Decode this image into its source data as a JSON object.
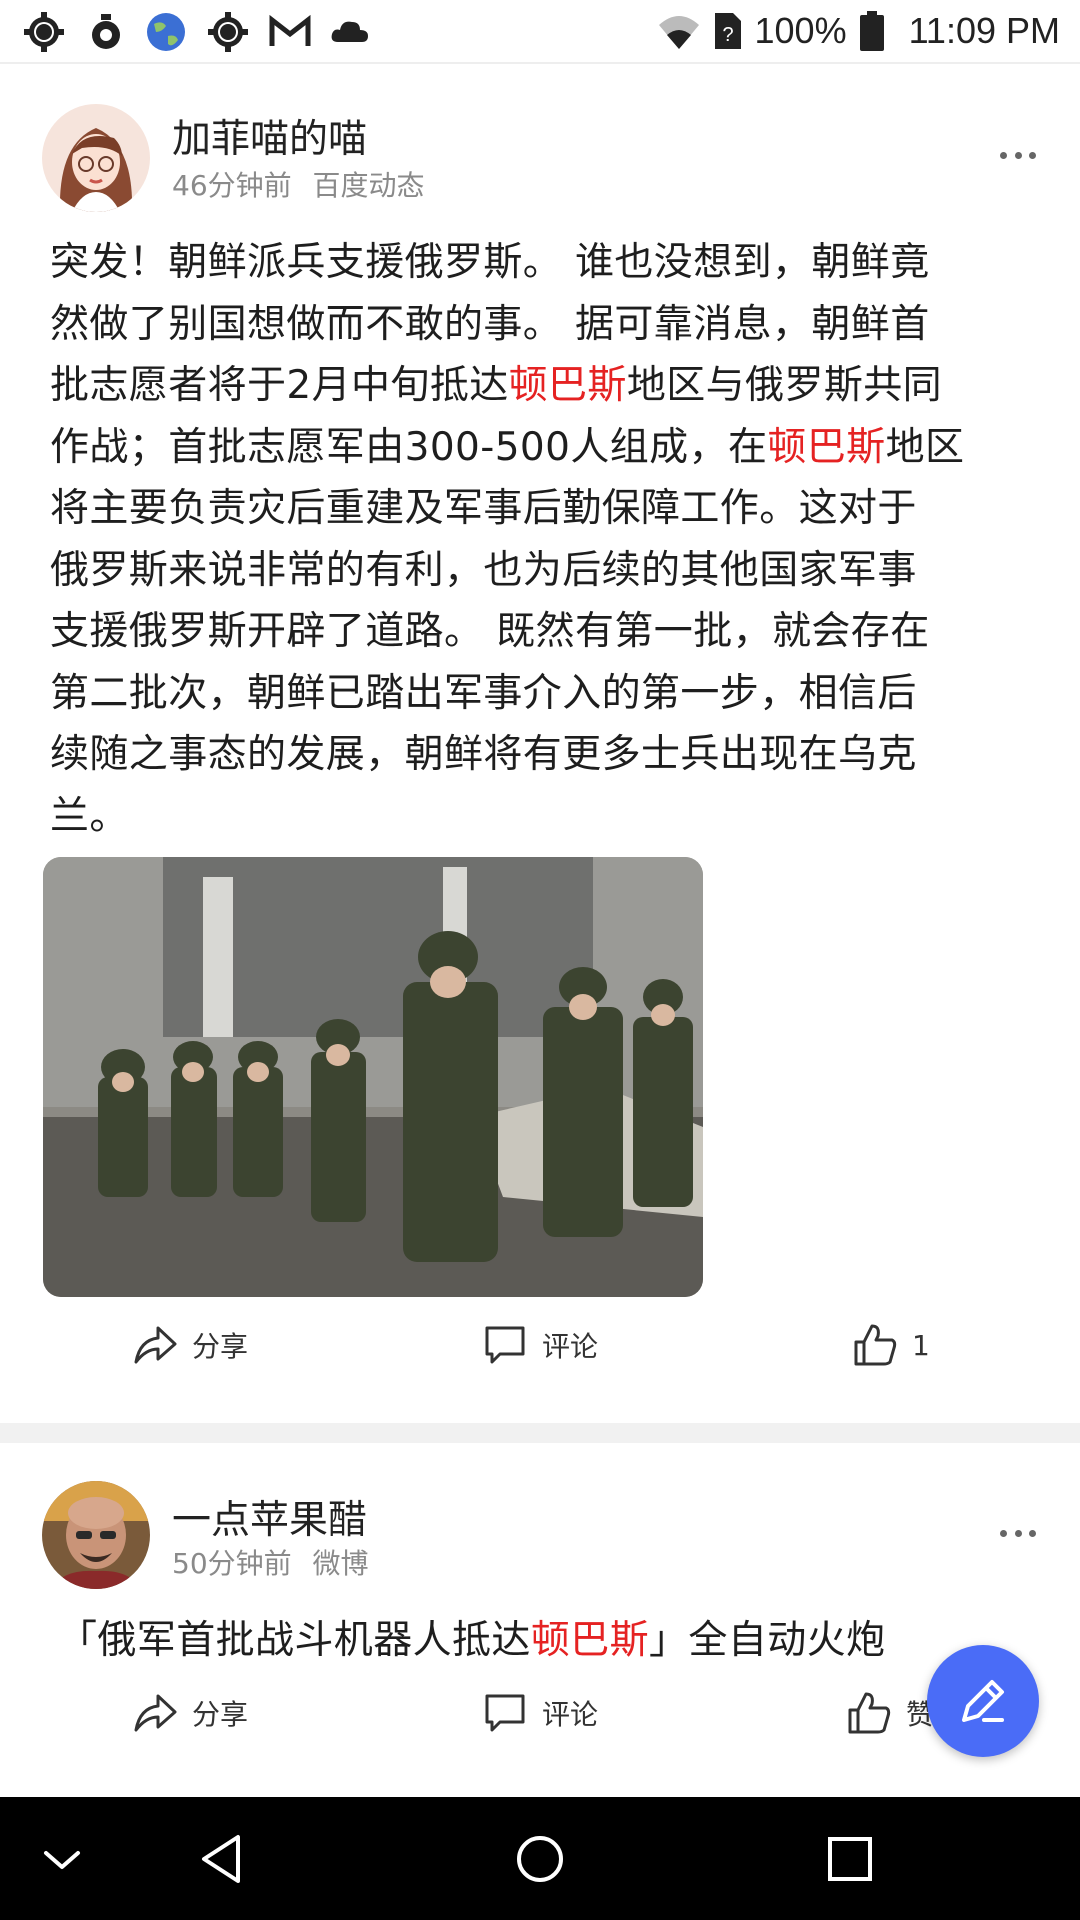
{
  "status_bar": {
    "battery": "100%",
    "time": "11:09 PM",
    "icons": [
      "settings-icon",
      "location-icon",
      "globe-icon",
      "settings-icon",
      "gmail-icon",
      "cloud-icon",
      "wifi-icon",
      "sim-unknown-icon",
      "battery-icon"
    ]
  },
  "posts": [
    {
      "author": "加菲喵的喵",
      "time": "46分钟前",
      "source": "百度动态",
      "text_lines": [
        "突发！朝鲜派兵支援俄罗斯。 谁也没想到，朝鲜竟",
        "然做了别国想做而不敢的事。 据可靠消息，朝鲜首",
        "批志愿者将于2月中旬抵达|顿巴斯|地区与俄罗斯共同",
        "作战；首批志愿军由300-500人组成，在|顿巴斯|地区",
        "将主要负责灾后重建及军事后勤保障工作。这对于",
        "俄罗斯来说非常的有利，也为后续的其他国家军事",
        "支援俄罗斯开辟了道路。 既然有第一批，就会存在",
        "第二批次，朝鲜已踏出军事介入的第一步，相信后",
        "续随之事态的发展，朝鲜将有更多士兵出现在乌克",
        "兰。"
      ],
      "actions": {
        "share": "分享",
        "comment": "评论",
        "like": "1"
      }
    },
    {
      "author": "一点苹果醋",
      "time": "50分钟前",
      "source": "微博",
      "text_pre": "「俄军首批战斗机器人抵达",
      "text_hl": "顿巴斯",
      "text_post": "」全自动火炮",
      "actions": {
        "share": "分享",
        "comment": "评论",
        "like": "赞"
      }
    }
  ],
  "colors": {
    "highlight": "#e52222",
    "fab": "#4a6cf7",
    "nav_bar": "#000000"
  }
}
